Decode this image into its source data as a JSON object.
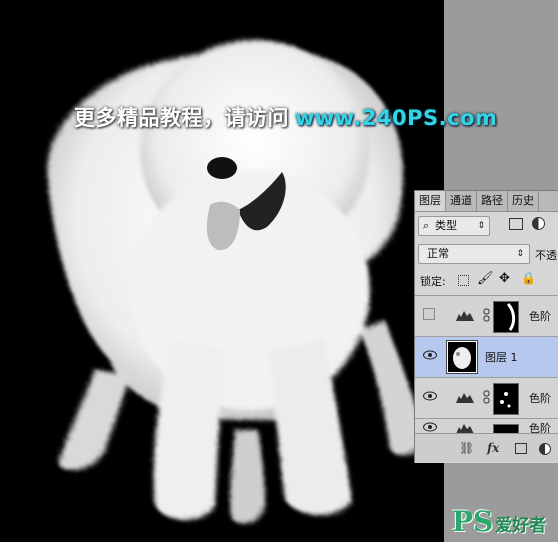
{
  "watermark": {
    "cn": "更多精品教程，请访问",
    "url": "www.240PS.com"
  },
  "layers_panel": {
    "tabs": [
      "图层",
      "通道",
      "路径",
      "历史"
    ],
    "filter": {
      "kind_label": "类型"
    },
    "blend_mode": "正常",
    "opacity_label": "不透",
    "lock_label": "锁定:",
    "layers": [
      {
        "name": "色阶",
        "type": "adjustment",
        "visible": false
      },
      {
        "name": "图层 1",
        "type": "pixel",
        "visible": true,
        "selected": true
      },
      {
        "name": "色阶",
        "type": "adjustment",
        "visible": true
      },
      {
        "name": "色阶",
        "type": "adjustment",
        "visible": true
      }
    ],
    "bottom_icons": [
      "link-icon",
      "fx-icon",
      "mask-icon",
      "adjustment-icon"
    ]
  },
  "logo": {
    "ps": "PS",
    "site": "爱好者"
  },
  "colors": {
    "accent_url": "#35d3e6",
    "panel_bg": "#d6d6d6",
    "selected_layer": "#b7c8ee",
    "logo_green": "#2aa86b"
  }
}
